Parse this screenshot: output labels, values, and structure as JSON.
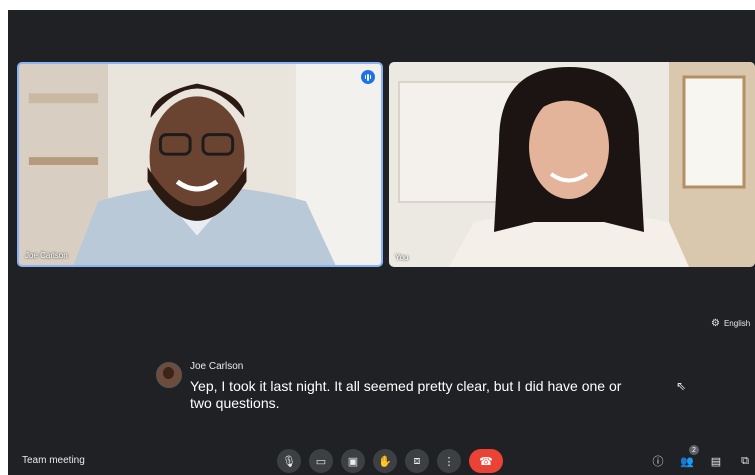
{
  "meeting": {
    "title": "Team meeting"
  },
  "participants": [
    {
      "name": "Joe Carlson",
      "speaking": true
    },
    {
      "name": "You",
      "speaking": false
    }
  ],
  "captions": {
    "language": "English",
    "speaker": "Joe Carlson",
    "text": "Yep, I took it last night. It all seemed pretty clear, but I did have one or two questions."
  },
  "controls": {
    "icons": [
      "mic-icon",
      "camera-icon",
      "captions-icon",
      "raise-hand-icon",
      "present-icon",
      "more-options-icon",
      "end-call-icon"
    ]
  },
  "right_panel": {
    "icons": [
      "info-icon",
      "people-icon",
      "chat-icon",
      "activities-icon"
    ],
    "people_count": "2"
  },
  "colors": {
    "background": "#202124",
    "accent": "#8ab4f8",
    "end_call": "#ea4335",
    "control": "#3c4043"
  }
}
